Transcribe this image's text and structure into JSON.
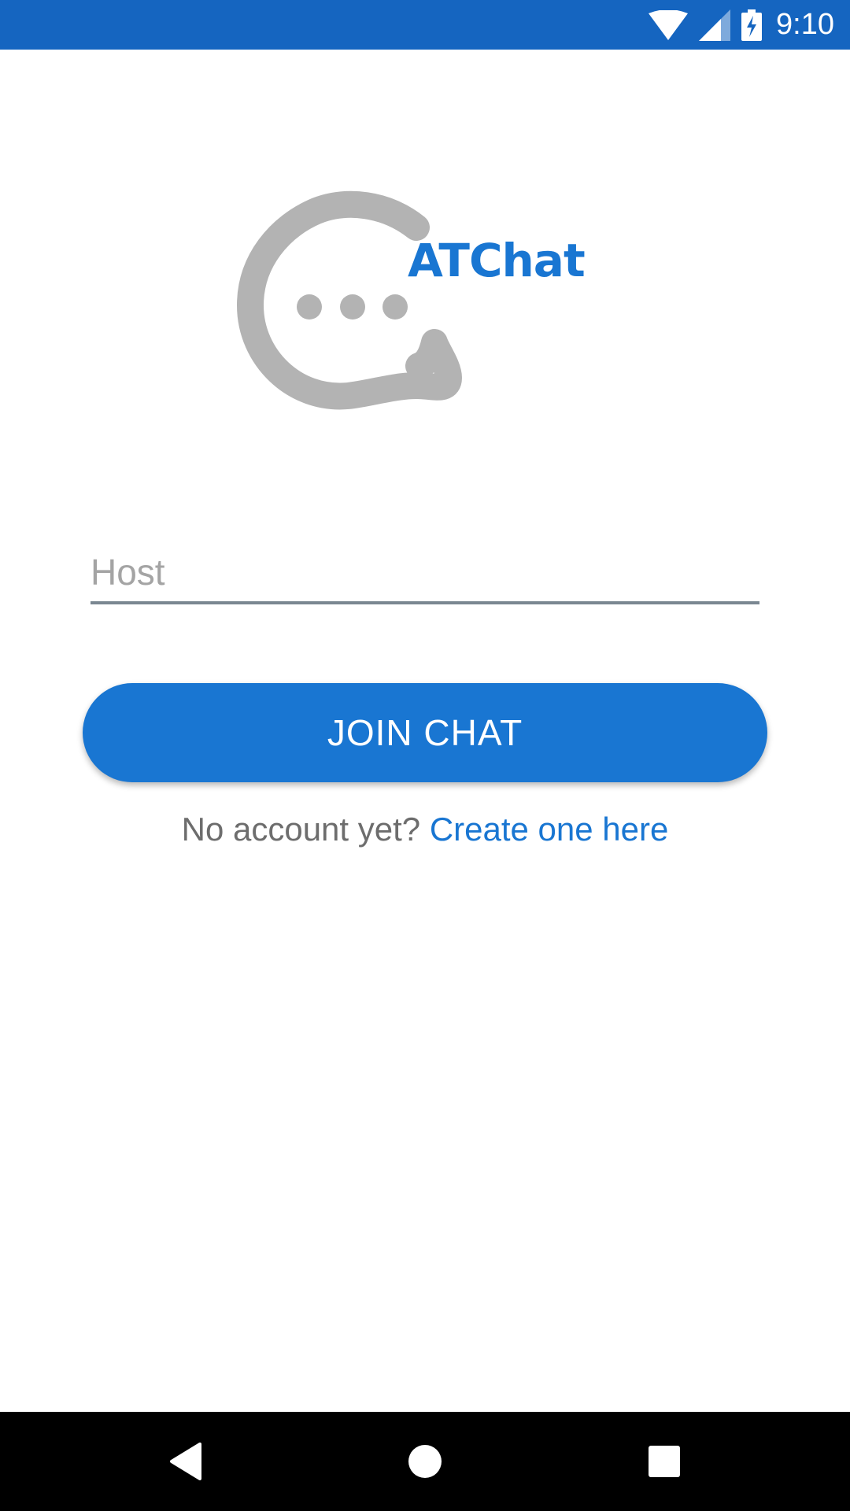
{
  "status_bar": {
    "time": "9:10",
    "icons": [
      "wifi-icon",
      "cellular-signal-icon",
      "battery-charging-icon"
    ]
  },
  "logo": {
    "wordmark": "ATChat",
    "bubble_color": "#b3b3b3",
    "wordmark_color": "#1976d2"
  },
  "host_input": {
    "placeholder": "Host",
    "value": ""
  },
  "join_button": {
    "label": "JOIN CHAT"
  },
  "signup": {
    "prompt": "No account yet?",
    "link_label": "Create one here"
  },
  "nav_bar": {
    "icons": [
      "back-icon",
      "home-icon",
      "recents-icon"
    ]
  },
  "colors": {
    "status_bar": "#1565c0",
    "primary": "#1976d2",
    "link": "#1976d2",
    "muted_text": "#6d6d6d"
  }
}
